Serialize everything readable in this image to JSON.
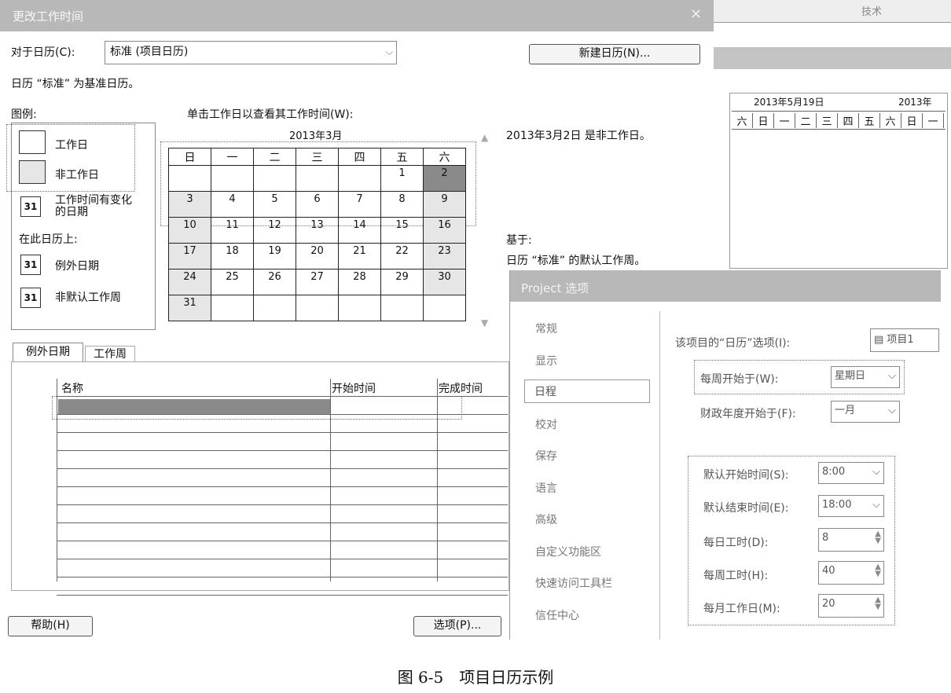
{
  "dialog_title": "更改工作时间",
  "for_calendar_label": "对于日历(C):",
  "calendar_select_value": "标准 (项目日历)",
  "new_calendar_button": "新建日历(N)...",
  "base_calendar_note": "日历 “标准” 为基准日历。",
  "legend": {
    "title": "图例:",
    "work_day": "工作日",
    "non_work_day": "非工作日",
    "changed_hours": "工作时间有变化的日期",
    "on_this_calendar": "在此日历上:",
    "exception_day": "例外日期",
    "nondefault_week": "非默认工作周",
    "icon_text": "31"
  },
  "calendar": {
    "instruction": "单击工作日以查看其工作时间(W):",
    "month_title": "2013年3月",
    "weekdays": [
      "日",
      "一",
      "二",
      "三",
      "四",
      "五",
      "六"
    ],
    "weeks": [
      [
        "",
        "",
        "",
        "",
        "",
        "1",
        "2"
      ],
      [
        "3",
        "4",
        "5",
        "6",
        "7",
        "8",
        "9"
      ],
      [
        "10",
        "11",
        "12",
        "13",
        "14",
        "15",
        "16"
      ],
      [
        "17",
        "18",
        "19",
        "20",
        "21",
        "22",
        "23"
      ],
      [
        "24",
        "25",
        "26",
        "27",
        "28",
        "29",
        "30"
      ],
      [
        "31",
        "",
        "",
        "",
        "",
        "",
        ""
      ]
    ]
  },
  "selected_day_info": "2013年3月2日 是非工作日。",
  "based_on_label": "基于:",
  "based_on_value": "日历 “标准” 的默认工作周。",
  "tabs": [
    "例外日期",
    "工作周"
  ],
  "exception_table": {
    "columns": [
      "名称",
      "开始时间",
      "完成时间"
    ]
  },
  "help_button": "帮助(H)",
  "options_button": "选项(P)...",
  "bg_window": {
    "top_label": "技术",
    "date_header_1": "2013年5月19日",
    "date_header_2": "2013年",
    "weekdays": [
      "六",
      "日",
      "一",
      "二",
      "三",
      "四",
      "五",
      "六",
      "日",
      "一"
    ]
  },
  "options_dialog": {
    "title": "Project 选项",
    "nav": [
      "常规",
      "显示",
      "日程",
      "校对",
      "保存",
      "语言",
      "高级",
      "自定义功能区",
      "快速访问工具栏",
      "信任中心"
    ],
    "selected_nav": "日程",
    "calendar_options_label": "该项目的“日历”选项(I):",
    "project_field": "项目1",
    "week_start_label": "每周开始于(W):",
    "week_start_value": "星期日",
    "fiscal_start_label": "财政年度开始于(F):",
    "fiscal_start_value": "一月",
    "default_start_label": "默认开始时间(S):",
    "default_start_value": "8:00",
    "default_end_label": "默认结束时间(E):",
    "default_end_value": "18:00",
    "hours_day_label": "每日工时(D):",
    "hours_day_value": "8",
    "hours_week_label": "每周工时(H):",
    "hours_week_value": "40",
    "days_month_label": "每月工作日(M):",
    "days_month_value": "20"
  },
  "caption": "图 6-5　项目日历示例"
}
